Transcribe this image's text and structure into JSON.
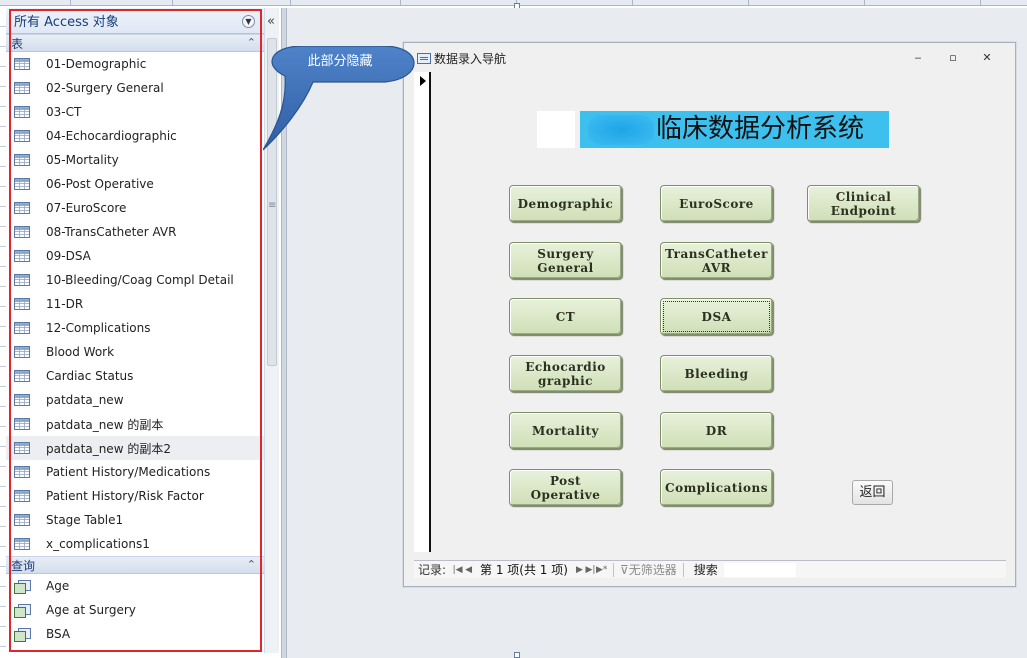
{
  "nav_pane": {
    "title": "所有 Access 对象",
    "collapse_glyph": "«",
    "groups": {
      "tables": {
        "label": "表",
        "items": [
          "01-Demographic",
          "02-Surgery General",
          "03-CT",
          "04-Echocardiographic",
          "05-Mortality",
          "06-Post Operative",
          "07-EuroScore",
          "08-TransCatheter AVR",
          "09-DSA",
          "10-Bleeding/Coag Compl Detail",
          "11-DR",
          "12-Complications",
          "Blood Work",
          "Cardiac Status",
          "patdata_new",
          "patdata_new 的副本",
          "patdata_new 的副本2",
          "Patient History/Medications",
          "Patient History/Risk Factor",
          "Stage Table1",
          "x_complications1"
        ],
        "selected_index": 16
      },
      "queries": {
        "label": "查询",
        "items": [
          "Age",
          "Age at Surgery",
          "BSA"
        ]
      }
    }
  },
  "callout": {
    "text": "此部分隐藏"
  },
  "form": {
    "window_title": "数据录入导航",
    "heading": "临床数据分析系统",
    "buttons": [
      "Demographic",
      "EuroScore",
      "Clinical\nEndpoint",
      "Surgery\nGeneral",
      "TransCatheter\nAVR",
      "CT",
      "DSA",
      "Echocardio\ngraphic",
      "Bleeding",
      "Mortality",
      "DR",
      "Post\nOperative",
      "Complications"
    ],
    "focused_button": "DSA",
    "back_label": "返回"
  },
  "record_nav": {
    "label": "记录:",
    "position": "第 1 项(共 1 项)",
    "filter": "无筛选器",
    "search": "搜索"
  },
  "colors": {
    "nav_highlight": "#e0252b",
    "heading_bg": "#3ec0ee",
    "button_bg": "#d8e6c6",
    "callout": "#3f6db3"
  }
}
